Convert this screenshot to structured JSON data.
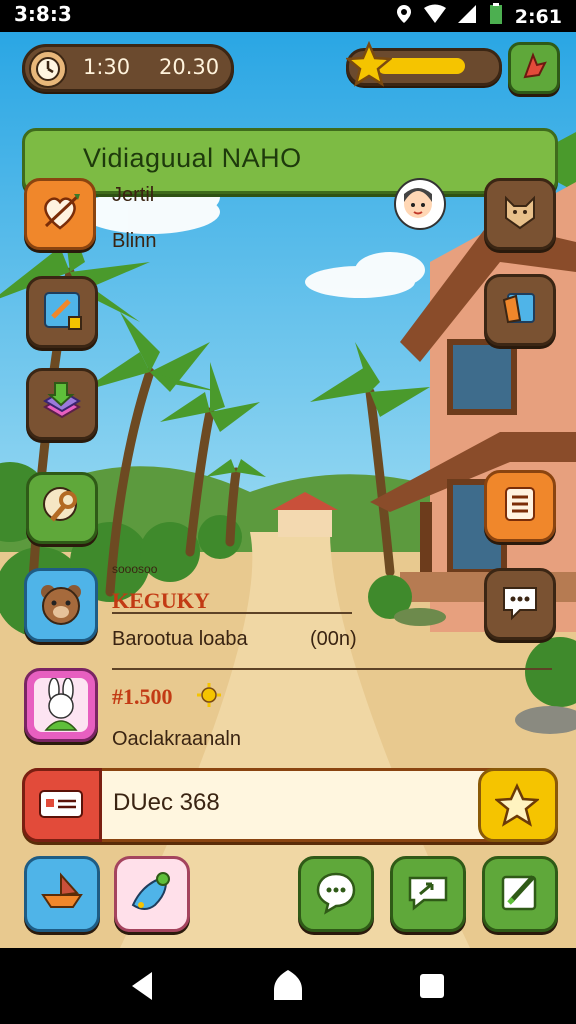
{
  "status_bar": {
    "time": "3:8:3",
    "battery_time": "2:61"
  },
  "hud": {
    "time_left": "1:30",
    "time_right": "20.30",
    "xp_fill": 0.8
  },
  "title": "Vidiaguual NAHO",
  "side_menu": {
    "label_1": "Jertil",
    "label_2": "Blinn"
  },
  "panel_1": {
    "heading": "KEGUKY",
    "subtitle": "Barootua loaba",
    "value": "(00n)",
    "small_text": "sooosoo"
  },
  "panel_2": {
    "heading": "1.500",
    "subtitle": "Oaclakraanaln"
  },
  "quest_bar": {
    "text": "DUec 368"
  },
  "colors": {
    "sky": "#3fb0e8",
    "accent_green": "#7dbb44",
    "wood": "#6b4a2e",
    "gold": "#f5c400"
  },
  "icons": [
    "clock-icon",
    "star-icon",
    "map-pin-icon",
    "heart-arrow-icon",
    "book-icon",
    "cards-icon",
    "magnifier-icon",
    "bear-avatar",
    "bunny-avatar",
    "ticket-icon",
    "chat-icon",
    "list-icon",
    "share-icon",
    "edit-icon"
  ]
}
